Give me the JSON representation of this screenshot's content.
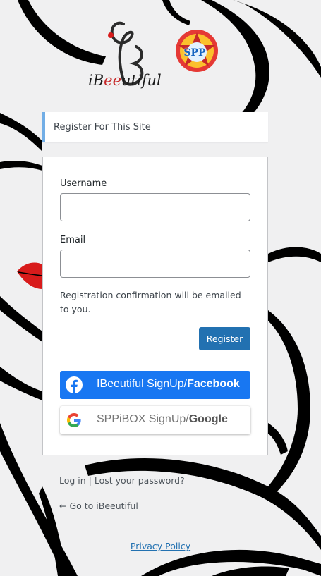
{
  "logo": {
    "text_pre": "iB",
    "text_accent": "ee",
    "text_post": "utiful",
    "badge_text": "SPP"
  },
  "message": "Register For This Site",
  "form": {
    "username_label": "Username",
    "username_value": "",
    "email_label": "Email",
    "email_value": "",
    "note": "Registration confirmation will be emailed to you.",
    "register_label": "Register",
    "facebook": {
      "prefix": "IBeeutiful SignUp/",
      "bold": "Facebook",
      "color": "#1877f2"
    },
    "google": {
      "prefix": "SPPiBOX SignUp/",
      "bold": "Google"
    }
  },
  "nav": {
    "login": "Log in",
    "separator": " | ",
    "lost_password": "Lost your password?"
  },
  "back_to_blog": "← Go to iBeeutiful",
  "privacy_policy": "Privacy Policy",
  "colors": {
    "primary": "#2271b1",
    "message_border": "#72aee6",
    "background": "#f0f0f1",
    "lips": "#d81b1b"
  }
}
